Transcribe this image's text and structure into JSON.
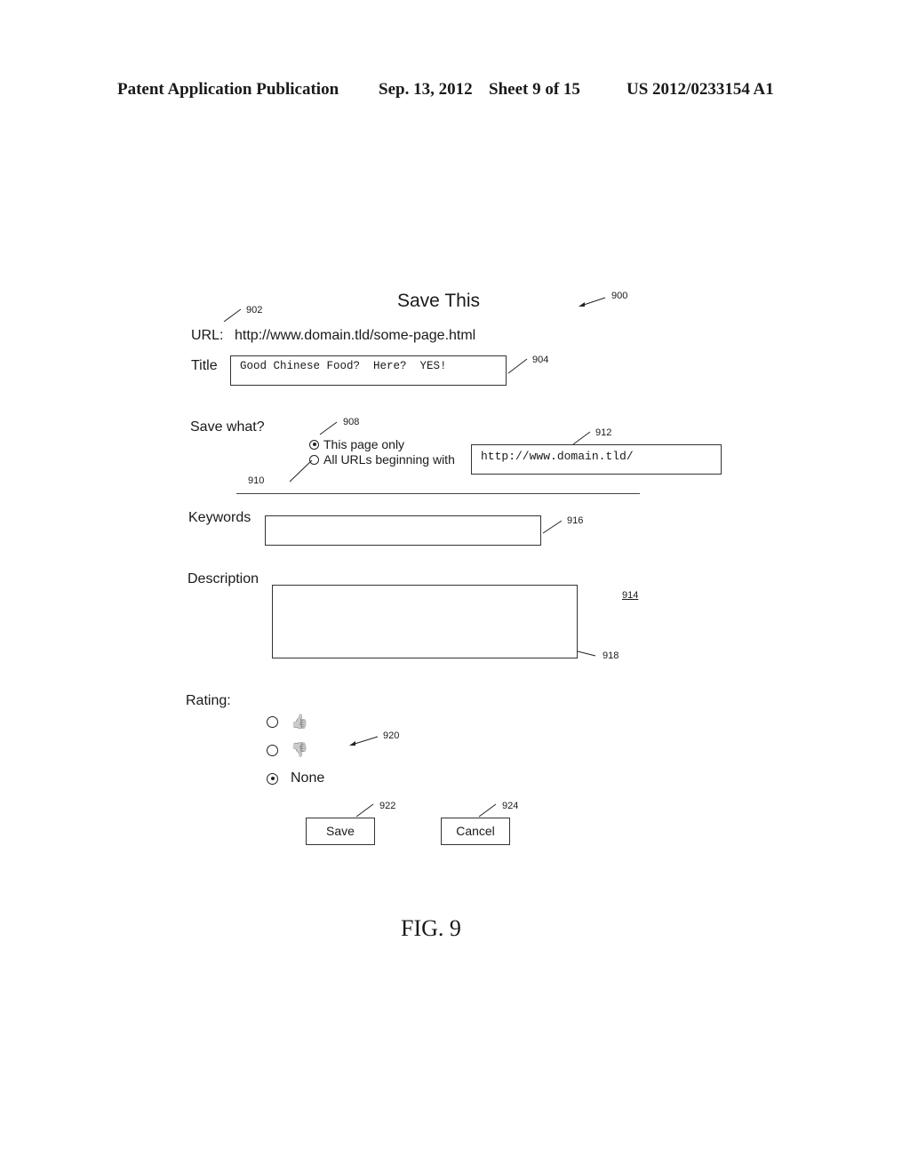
{
  "header": {
    "publication": "Patent Application Publication",
    "date": "Sep. 13, 2012",
    "sheet": "Sheet 9 of 15",
    "patent_number": "US 2012/0233154 A1"
  },
  "dialog": {
    "title": "Save This",
    "url_label": "URL:",
    "url_value": "http://www.domain.tld/some-page.html",
    "title_label": "Title",
    "title_value": "Good Chinese Food?  Here?  YES!",
    "save_what_label": "Save what?",
    "save_options": [
      {
        "label": "This page only",
        "selected": true
      },
      {
        "label": "All URLs beginning with",
        "selected": false
      }
    ],
    "url_prefix_value": "http://www.domain.tld/",
    "keywords_label": "Keywords",
    "keywords_value": "",
    "description_label": "Description",
    "description_value": "",
    "rating_label": "Rating:",
    "rating_options": [
      {
        "icon": "thumbs-up-icon",
        "glyph": "👍",
        "selected": false
      },
      {
        "icon": "thumbs-down-icon",
        "glyph": "👎",
        "selected": false
      },
      {
        "label": "None",
        "selected": true
      }
    ],
    "save_button": "Save",
    "cancel_button": "Cancel"
  },
  "reference_numerals": {
    "r900": "900",
    "r902": "902",
    "r904": "904",
    "r908": "908",
    "r910": "910",
    "r912": "912",
    "r914": "914",
    "r916": "916",
    "r918": "918",
    "r920": "920",
    "r922": "922",
    "r924": "924"
  },
  "figure_label": "FIG. 9"
}
